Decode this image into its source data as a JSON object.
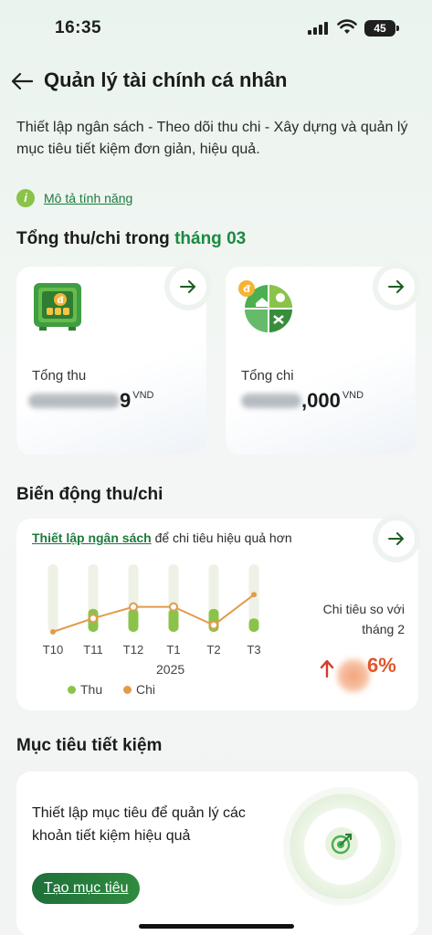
{
  "status_bar": {
    "time": "16:35",
    "battery": "45"
  },
  "header": {
    "title": "Quản lý tài chính cá nhân"
  },
  "description": "Thiết lập ngân sách - Theo dõi thu chi - Xây dựng và quản lý mục tiêu tiết kiệm đơn giản, hiệu quả.",
  "feature_link": "Mô tả tính năng",
  "summary": {
    "title_prefix": "Tổng thu/chi trong",
    "title_month": "tháng 03",
    "income": {
      "label": "Tổng thu",
      "amount_suffix": "9",
      "currency": "VND"
    },
    "expense": {
      "label": "Tổng chi",
      "amount_suffix": ",000",
      "currency": "VND"
    }
  },
  "trend": {
    "title": "Biến động thu/chi",
    "budget_link": "Thiết lập ngân sách",
    "budget_text": " để chi tiêu hiệu quả hơn",
    "compare_label": "Chi tiêu so với tháng 2",
    "compare_pct": "6%",
    "year_label": "2025",
    "legend": {
      "income": "Thu",
      "expense": "Chi"
    }
  },
  "chart_data": {
    "type": "bar",
    "categories": [
      "T10",
      "T11",
      "T12",
      "T1",
      "T2",
      "T3"
    ],
    "series": [
      {
        "name": "Thu",
        "values": [
          0,
          0.34,
          0.34,
          0.34,
          0.34,
          0.2
        ]
      },
      {
        "name": "Chi",
        "values": [
          0,
          0.2,
          0.37,
          0.37,
          0.1,
          0.55
        ]
      }
    ],
    "ylim": [
      0,
      1
    ],
    "colors": {
      "Thu": "#8bc34a",
      "Chi": "#e39a4c",
      "track": "#eef2e6"
    }
  },
  "savings": {
    "title": "Mục tiêu tiết kiệm",
    "text": "Thiết lập mục tiêu để quản lý các khoản tiết kiệm hiệu quả",
    "button": "Tạo mục tiêu"
  }
}
